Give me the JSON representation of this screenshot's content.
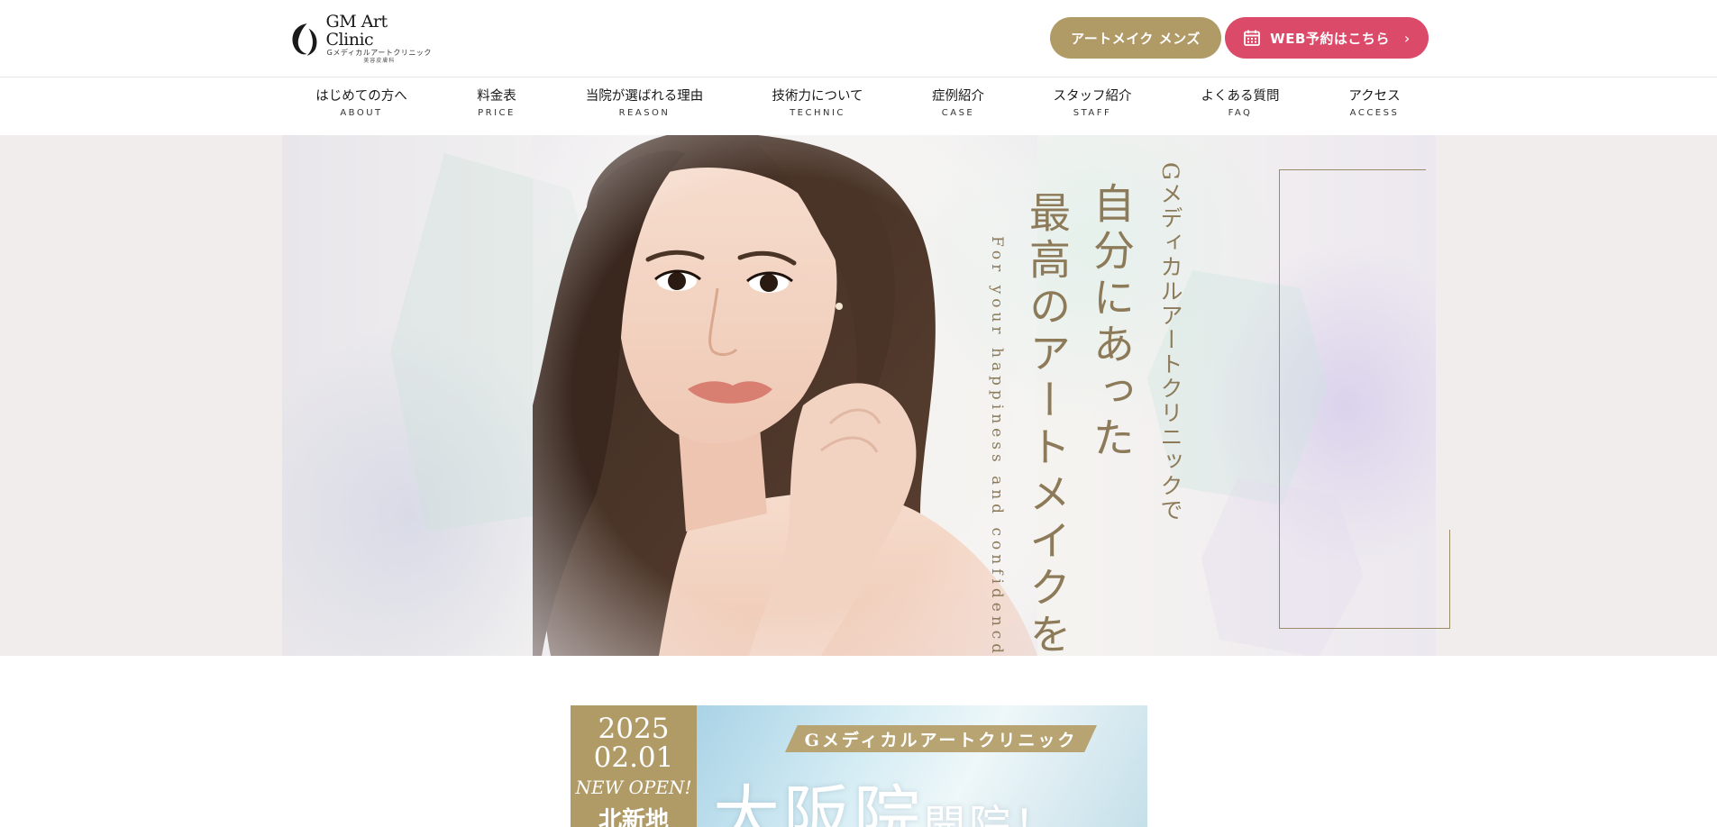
{
  "header": {
    "logo": {
      "title": "GM Art Clinic",
      "subtitle": "Gメディカルアートクリニック",
      "tagline": "美容皮膚科"
    },
    "mens_button": "アートメイク メンズ",
    "web_button": "WEB予約はこちら",
    "web_button_arrow": "›",
    "colors": {
      "mens": "#b09b67",
      "web": "#dc4a6a"
    }
  },
  "nav": {
    "items": [
      {
        "jp": "はじめての方へ",
        "en": "ABOUT"
      },
      {
        "jp": "料金表",
        "en": "PRICE"
      },
      {
        "jp": "当院が選ばれる理由",
        "en": "REASON"
      },
      {
        "jp": "技術力について",
        "en": "TECHNIC"
      },
      {
        "jp": "症例紹介",
        "en": "CASE"
      },
      {
        "jp": "スタッフ紹介",
        "en": "STAFF"
      },
      {
        "jp": "よくある質問",
        "en": "FAQ"
      },
      {
        "jp": "アクセス",
        "en": "ACCESS"
      }
    ]
  },
  "hero": {
    "clinic_line": "Gメディカルアートクリニックで",
    "catch_line1": "自分にあった",
    "catch_line2": "最高のアートメイクを。",
    "english": "For your happiness and confidencd."
  },
  "banner": {
    "year": "2025",
    "month_day": "02.01",
    "new_open": "NEW OPEN!",
    "location": "北新地",
    "ribbon": "Gメディカルアートクリニック",
    "headline_big": "大阪院",
    "headline_small": "開院！"
  }
}
